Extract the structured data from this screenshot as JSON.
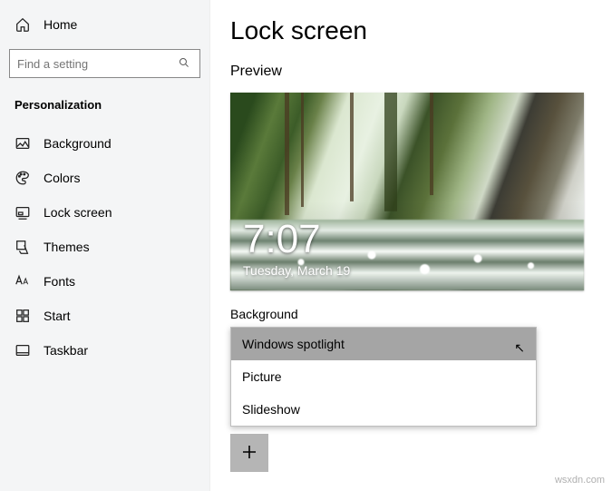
{
  "sidebar": {
    "home_label": "Home",
    "search_placeholder": "Find a setting",
    "section_header": "Personalization",
    "items": [
      {
        "label": "Background"
      },
      {
        "label": "Colors"
      },
      {
        "label": "Lock screen"
      },
      {
        "label": "Themes"
      },
      {
        "label": "Fonts"
      },
      {
        "label": "Start"
      },
      {
        "label": "Taskbar"
      }
    ]
  },
  "main": {
    "title": "Lock screen",
    "preview_header": "Preview",
    "clock": {
      "time": "7:07",
      "date": "Tuesday, March 19"
    },
    "bg_label": "Background",
    "dropdown": {
      "options": [
        {
          "label": "Windows spotlight",
          "selected": true
        },
        {
          "label": "Picture",
          "selected": false
        },
        {
          "label": "Slideshow",
          "selected": false
        }
      ]
    }
  },
  "watermark": "wsxdn.com"
}
